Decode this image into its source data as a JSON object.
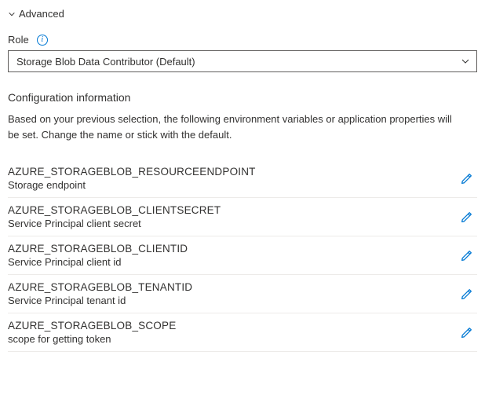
{
  "advanced": {
    "label": "Advanced"
  },
  "role": {
    "label": "Role",
    "selected": "Storage Blob Data Contributor (Default)"
  },
  "config": {
    "title": "Configuration information",
    "description": "Based on your previous selection, the following environment variables or application properties will be set. Change the name or stick with the default."
  },
  "variables": [
    {
      "name": "AZURE_STORAGEBLOB_RESOURCEENDPOINT",
      "desc": "Storage endpoint"
    },
    {
      "name": "AZURE_STORAGEBLOB_CLIENTSECRET",
      "desc": "Service Principal client secret"
    },
    {
      "name": "AZURE_STORAGEBLOB_CLIENTID",
      "desc": "Service Principal client id"
    },
    {
      "name": "AZURE_STORAGEBLOB_TENANTID",
      "desc": "Service Principal tenant id"
    },
    {
      "name": "AZURE_STORAGEBLOB_SCOPE",
      "desc": "scope for getting token"
    }
  ]
}
